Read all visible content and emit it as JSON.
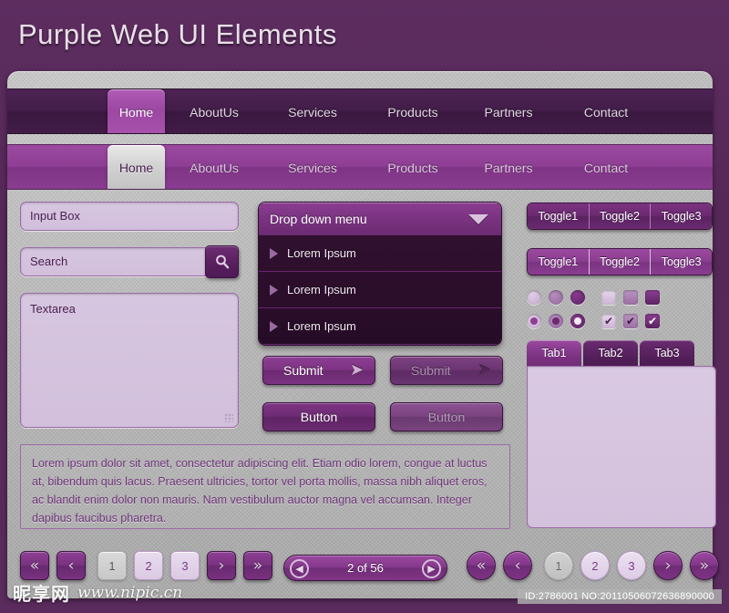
{
  "header": {
    "title": "Purple Web UI Elements"
  },
  "nav_dark": {
    "items": [
      {
        "label": "Home",
        "active": true
      },
      {
        "label": "AboutUs",
        "active": false
      },
      {
        "label": "Services",
        "active": false
      },
      {
        "label": "Products",
        "active": false
      },
      {
        "label": "Partners",
        "active": false
      },
      {
        "label": "Contact",
        "active": false
      }
    ]
  },
  "nav_light": {
    "items": [
      {
        "label": "Home",
        "active": true
      },
      {
        "label": "AboutUs",
        "active": false
      },
      {
        "label": "Services",
        "active": false
      },
      {
        "label": "Products",
        "active": false
      },
      {
        "label": "Partners",
        "active": false
      },
      {
        "label": "Contact",
        "active": false
      }
    ]
  },
  "left": {
    "input_box": {
      "value": "Input Box",
      "placeholder": "Input Box"
    },
    "search": {
      "value": "Search",
      "placeholder": "Search",
      "icon": "search-icon"
    },
    "textarea": {
      "value": "Textarea",
      "placeholder": "Textarea"
    },
    "paragraph": "Lorem ipsum dolor sit amet, consectetur adipiscing elit. Etiam odio lorem, congue at luctus at, bibendum quis lacus. Praesent ultricies, tortor vel porta mollis, massa nibh aliquet eros, ac blandit enim dolor non mauris. Nam vestibulum auctor magna vel accumsan. Integer dapibus faucibus pharetra."
  },
  "middle": {
    "dropdown": {
      "label": "Drop down menu",
      "caret_icon": "chevron-down-icon",
      "items": [
        "Lorem Ipsum",
        "Lorem Ipsum",
        "Lorem Ipsum"
      ]
    },
    "buttons": {
      "submit_enabled": "Submit",
      "submit_disabled": "Submit",
      "button_enabled": "Button",
      "button_disabled": "Button",
      "submit_icon": "chevron-right-icon"
    }
  },
  "right": {
    "toggles_dark": [
      "Toggle1",
      "Toggle2",
      "Toggle3"
    ],
    "toggles_light": [
      "Toggle1",
      "Toggle2",
      "Toggle3"
    ],
    "radios": [
      {
        "tone": "l",
        "checked": false
      },
      {
        "tone": "m",
        "checked": false
      },
      {
        "tone": "d",
        "checked": false
      },
      {
        "tone": "l",
        "checked": true
      },
      {
        "tone": "m",
        "checked": true
      },
      {
        "tone": "d",
        "checked": true
      }
    ],
    "checkboxes": [
      {
        "tone": "l",
        "checked": false
      },
      {
        "tone": "m",
        "checked": false
      },
      {
        "tone": "d",
        "checked": false
      },
      {
        "tone": "l",
        "checked": true
      },
      {
        "tone": "m",
        "checked": true
      },
      {
        "tone": "d",
        "checked": true
      }
    ],
    "check_glyph": "✔",
    "tabs": [
      {
        "label": "Tab1",
        "active": true
      },
      {
        "label": "Tab2",
        "active": false
      },
      {
        "label": "Tab3",
        "active": false
      }
    ]
  },
  "pagination_square": {
    "first_icon": "«",
    "prev_icon": "‹",
    "next_icon": "›",
    "last_icon": "»",
    "pages": [
      "1",
      "2",
      "3"
    ],
    "current_page": "1"
  },
  "pager": {
    "text": "2 of 56",
    "prev_icon": "◀",
    "next_icon": "▶"
  },
  "pagination_round": {
    "first_icon": "«",
    "prev_icon": "‹",
    "next_icon": "›",
    "last_icon": "»",
    "pages": [
      "1",
      "2",
      "3"
    ],
    "current_page": "1"
  },
  "watermark": {
    "cn": "昵享网",
    "url": "www.nipic.cn",
    "id_text": "ID:2786001 NO:20110506072636890000"
  },
  "colors": {
    "page_bg": "#5a2b5d",
    "panel_bg": "#b4b4b4",
    "accent": "#8b3d91",
    "accent_dark": "#4e2354",
    "field_bg": "#d4c1dd",
    "text_purple": "#70357b"
  }
}
